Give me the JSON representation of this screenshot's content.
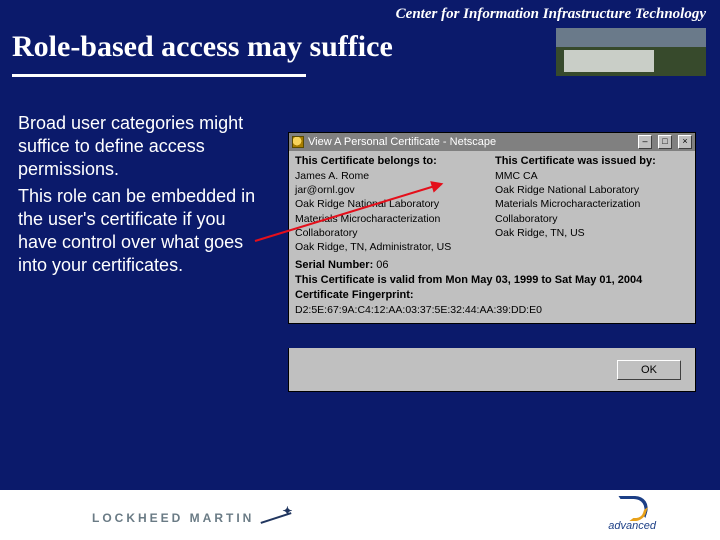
{
  "header": {
    "org": "Center for Information Infrastructure Technology"
  },
  "title": "Role-based access may suffice",
  "body": {
    "p1": "Broad user categories might suffice to define access permissions.",
    "p2": "This role can be embedded in the user's certificate if you have control over what goes into your certificates."
  },
  "cert_window": {
    "title": "View A Personal Certificate - Netscape",
    "minimize_glyph": "–",
    "maximize_glyph": "□",
    "close_glyph": "×",
    "belongs_header": "This Certificate belongs to:",
    "issued_header": "This Certificate was issued by:",
    "belongs": {
      "l1": "James A. Rome",
      "l2": "jar@ornl.gov",
      "l3": "Oak Ridge National Laboratory",
      "l4": "Materials Microcharacterization",
      "l5": "Collaboratory",
      "l6": "Oak Ridge, TN, Administrator, US"
    },
    "issued": {
      "l1": "MMC CA",
      "l2": "Oak Ridge National Laboratory",
      "l3": "Materials Microcharacterization",
      "l4": "Collaboratory",
      "l5": "Oak Ridge, TN, US"
    },
    "serial_label": "Serial Number:",
    "serial_value": " 06",
    "valid_label": "This Certificate is valid from ",
    "valid_value": "Mon May 03, 1999 to Sat May 01, 2004",
    "fp_label": "Certificate Fingerprint:",
    "fp_value": "D2:5E:67:9A:C4:12:AA:03:37:5E:32:44:AA:39:DD:E0",
    "ok_label": "OK"
  },
  "footer": {
    "lm": "LOCKHEED MARTIN",
    "adv": "advanced"
  }
}
